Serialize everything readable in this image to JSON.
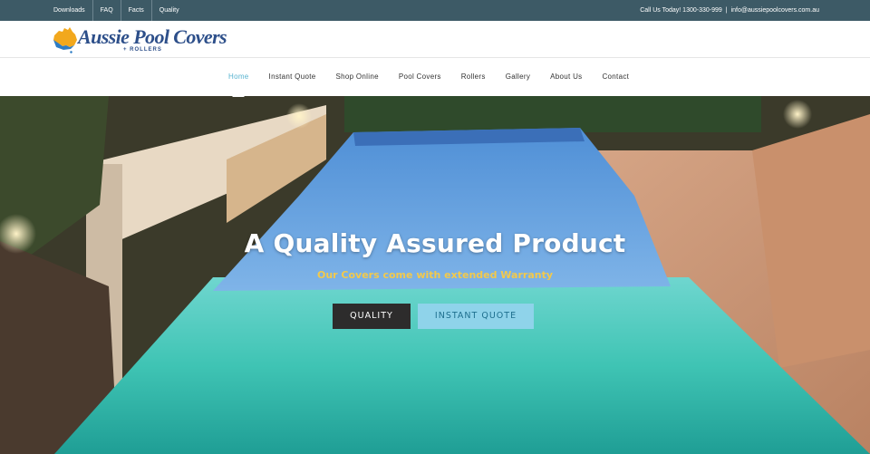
{
  "topbar": {
    "links": [
      {
        "label": "Downloads"
      },
      {
        "label": "FAQ"
      },
      {
        "label": "Facts"
      },
      {
        "label": "Quality"
      }
    ],
    "call_text": "Call Us Today! 1300-330-999",
    "separator": "|",
    "email": "info@aussiepoolcovers.com.au"
  },
  "logo": {
    "name": "Aussie Pool Covers",
    "tagline": "+ ROLLERS"
  },
  "nav": {
    "items": [
      {
        "label": "Home",
        "active": true
      },
      {
        "label": "Instant Quote"
      },
      {
        "label": "Shop Online"
      },
      {
        "label": "Pool Covers"
      },
      {
        "label": "Rollers"
      },
      {
        "label": "Gallery"
      },
      {
        "label": "About Us"
      },
      {
        "label": "Contact"
      }
    ]
  },
  "hero": {
    "title": "A Quality Assured Product",
    "subtitle": "Our Covers come with extended Warranty",
    "buttons": {
      "quality": "QUALITY",
      "instant_quote": "INSTANT QUOTE"
    }
  },
  "colors": {
    "topbar": "#3d5a66",
    "brand_blue": "#2d4f8a",
    "nav_active": "#57b3cf",
    "subtitle_yellow": "#f2c94c",
    "quote_button": "#8fd3ea",
    "quality_button": "#2d2c2c"
  }
}
